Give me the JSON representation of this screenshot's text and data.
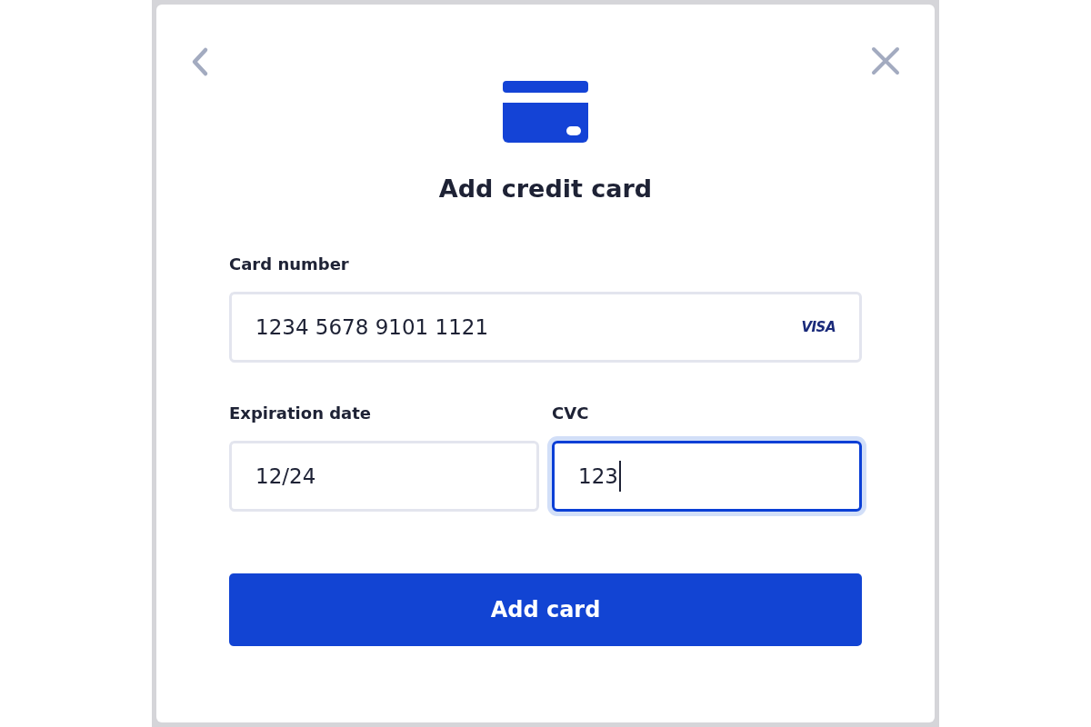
{
  "dialog": {
    "title": "Add credit card"
  },
  "fields": [
    {
      "kind": "full",
      "label": "Card number",
      "value": "1234 5678 9101 1121",
      "brand": "VISA",
      "focused": false
    },
    {
      "kind": "half",
      "label": "Expiration date",
      "value": "12/24",
      "focused": false
    },
    {
      "kind": "half",
      "label": "CVC",
      "value": "123",
      "focused": true
    }
  ],
  "submit": {
    "label": "Add card"
  }
}
